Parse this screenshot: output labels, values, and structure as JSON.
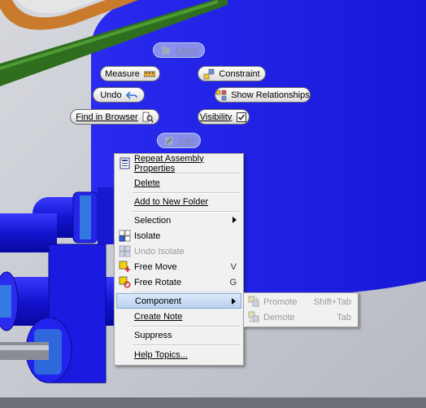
{
  "marking_menu": {
    "open": "Open",
    "measure": "Measure",
    "constraint": "Constraint",
    "undo": "Undo",
    "show_relationships": "Show Relationships",
    "find_in_browser": "Find in Browser",
    "visibility": "Visibility",
    "edit": "Edit"
  },
  "context_menu": {
    "repeat_assembly_properties": "Repeat Assembly Properties",
    "delete": "Delete",
    "add_to_new_folder": "Add to New Folder",
    "selection": "Selection",
    "isolate": "Isolate",
    "undo_isolate": "Undo Isolate",
    "free_move": "Free Move",
    "free_move_shortcut": "V",
    "free_rotate": "Free Rotate",
    "free_rotate_shortcut": "G",
    "component": "Component",
    "create_note": "Create Note",
    "suppress": "Suppress",
    "help_topics": "Help Topics..."
  },
  "component_submenu": {
    "promote": "Promote",
    "promote_shortcut": "Shift+Tab",
    "demote": "Demote",
    "demote_shortcut": "Tab"
  },
  "colors": {
    "viewport_background": "#c9ccd4",
    "tank_blue": "#1c1ce6",
    "pipe_green": "#2f6e1e",
    "pipe_orange": "#c97a2c",
    "menu_highlight": "#b9d2f0"
  }
}
